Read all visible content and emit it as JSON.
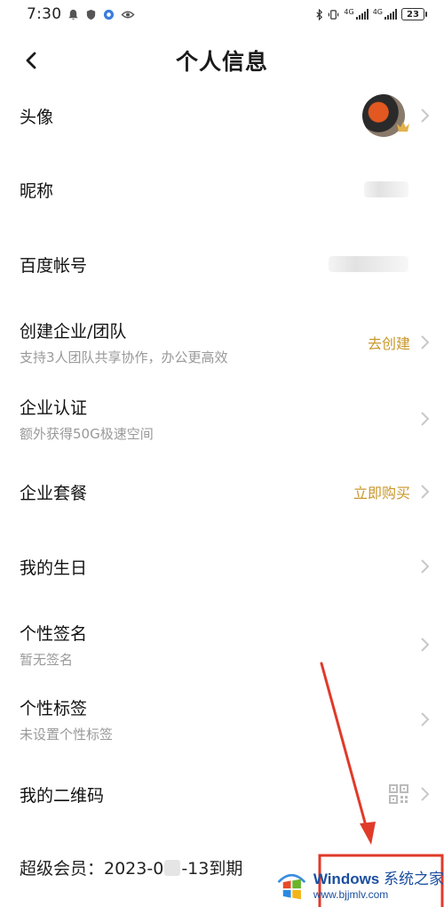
{
  "status_bar": {
    "time": "7:30",
    "battery": "23",
    "net_labels": [
      "4G",
      "4G"
    ]
  },
  "nav": {
    "title": "个人信息"
  },
  "rows": [
    {
      "label": "头像",
      "sub": "",
      "action": ""
    },
    {
      "label": "昵称",
      "sub": "",
      "action": ""
    },
    {
      "label": "百度帐号",
      "sub": "",
      "action": ""
    },
    {
      "label": "创建企业/团队",
      "sub": "支持3人团队共享协作，办公更高效",
      "action": "去创建"
    },
    {
      "label": "企业认证",
      "sub": "额外获得50G极速空间",
      "action": ""
    },
    {
      "label": "企业套餐",
      "sub": "",
      "action": "立即购买"
    },
    {
      "label": "我的生日",
      "sub": "",
      "action": ""
    },
    {
      "label": "个性签名",
      "sub": "暂无签名",
      "action": ""
    },
    {
      "label": "个性标签",
      "sub": "未设置个性标签",
      "action": ""
    },
    {
      "label": "我的二维码",
      "sub": "",
      "action": ""
    }
  ],
  "vip": {
    "prefix": "超级会员：2023-0",
    "suffix": "-13到期"
  },
  "watermark": {
    "brand": "Windows",
    "brand_cn": "系统之家",
    "url": "www.bjjmlv.com"
  },
  "colors": {
    "accent": "#c9972a",
    "annotation_red": "#e03a2a",
    "chevron": "#c8c8c8"
  }
}
